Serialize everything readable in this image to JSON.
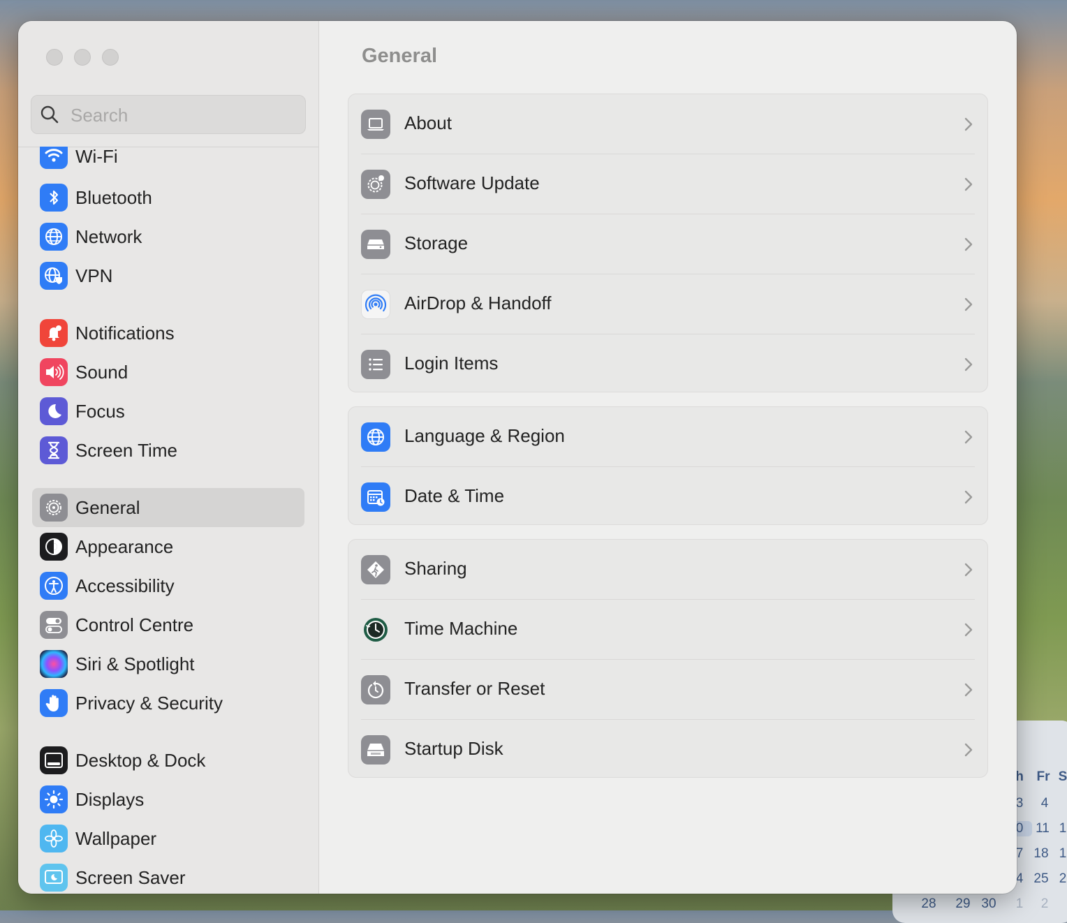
{
  "calendar": {
    "days_header": [
      "h",
      "Fr",
      "S"
    ],
    "rows": [
      [
        "3",
        "4",
        ""
      ],
      [
        "0",
        "11",
        "1"
      ],
      [
        "7",
        "18",
        "1"
      ],
      [
        "4",
        "25",
        "2"
      ],
      [
        "28",
        "29",
        "30",
        "1",
        "2"
      ]
    ]
  },
  "sidebar": {
    "search_placeholder": "Search",
    "items": [
      {
        "label": "Wi-Fi",
        "icon": "wifi-icon",
        "color": "#2f7cf6"
      },
      {
        "label": "Bluetooth",
        "icon": "bluetooth-icon",
        "color": "#2f7cf6"
      },
      {
        "label": "Network",
        "icon": "globe-icon",
        "color": "#2f7cf6"
      },
      {
        "label": "VPN",
        "icon": "vpn-globe-icon",
        "color": "#2f7cf6"
      },
      {
        "label": "Notifications",
        "icon": "bell-icon",
        "color": "#f0453a"
      },
      {
        "label": "Sound",
        "icon": "speaker-icon",
        "color": "#f0455f"
      },
      {
        "label": "Focus",
        "icon": "moon-icon",
        "color": "#5d5ad6"
      },
      {
        "label": "Screen Time",
        "icon": "hourglass-icon",
        "color": "#5d5ad6"
      },
      {
        "label": "General",
        "icon": "gear-icon",
        "color": "#8e8e93"
      },
      {
        "label": "Appearance",
        "icon": "appearance-icon",
        "color": "#1c1c1e"
      },
      {
        "label": "Accessibility",
        "icon": "accessibility-icon",
        "color": "#2f7cf6"
      },
      {
        "label": "Control Centre",
        "icon": "toggles-icon",
        "color": "#8e8e93"
      },
      {
        "label": "Siri & Spotlight",
        "icon": "siri-icon",
        "color": "#3a2f6e"
      },
      {
        "label": "Privacy & Security",
        "icon": "hand-icon",
        "color": "#2f7cf6"
      },
      {
        "label": "Desktop & Dock",
        "icon": "dock-icon",
        "color": "#1c1c1e"
      },
      {
        "label": "Displays",
        "icon": "sun-icon",
        "color": "#2f7cf6"
      },
      {
        "label": "Wallpaper",
        "icon": "flower-icon",
        "color": "#4fb7f0"
      },
      {
        "label": "Screen Saver",
        "icon": "screen-saver-icon",
        "color": "#5fc4ee"
      }
    ]
  },
  "main": {
    "title": "General",
    "groups": [
      [
        {
          "label": "About",
          "icon": "laptop-icon"
        },
        {
          "label": "Software Update",
          "icon": "gear-badge-icon"
        },
        {
          "label": "Storage",
          "icon": "drive-icon"
        },
        {
          "label": "AirDrop & Handoff",
          "icon": "airdrop-icon"
        },
        {
          "label": "Login Items",
          "icon": "list-icon"
        }
      ],
      [
        {
          "label": "Language & Region",
          "icon": "globe-icon"
        },
        {
          "label": "Date & Time",
          "icon": "calendar-clock-icon"
        }
      ],
      [
        {
          "label": "Sharing",
          "icon": "sharing-icon"
        },
        {
          "label": "Time Machine",
          "icon": "time-machine-icon"
        },
        {
          "label": "Transfer or Reset",
          "icon": "reset-icon"
        },
        {
          "label": "Startup Disk",
          "icon": "startup-disk-icon"
        }
      ]
    ]
  }
}
